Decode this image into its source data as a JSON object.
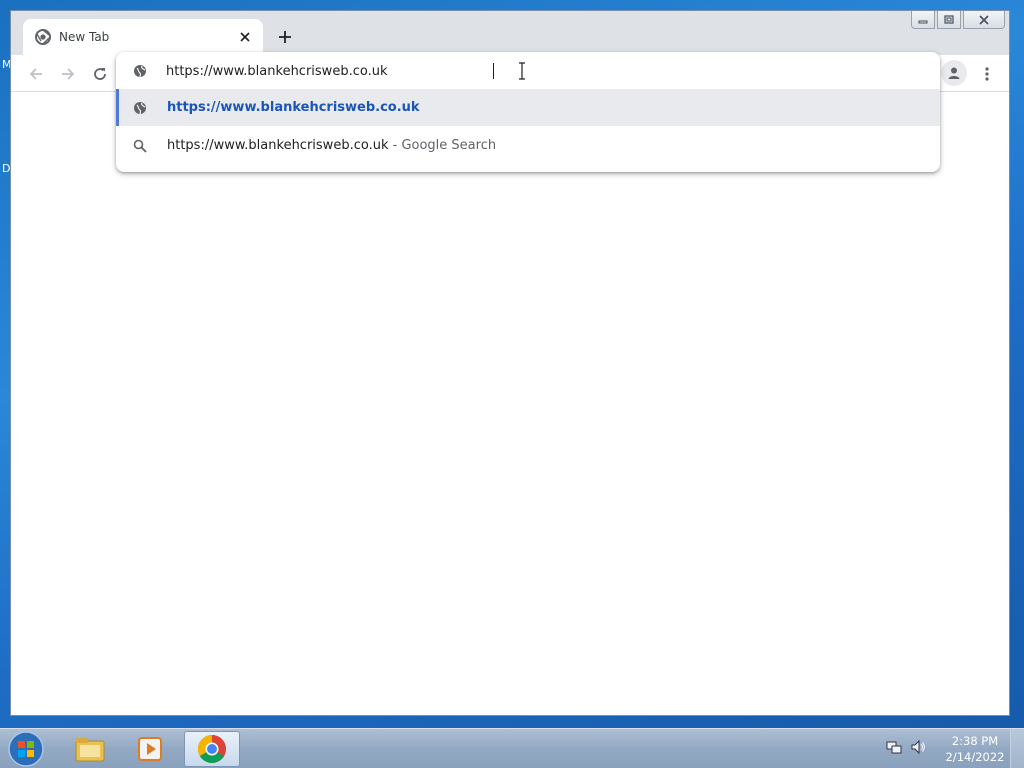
{
  "desktop": {
    "edge_letters": [
      "M",
      "D"
    ]
  },
  "browser": {
    "tab": {
      "title": "New Tab",
      "favicon": "chrome-icon",
      "close_icon": "close-icon"
    },
    "new_tab_icon": "plus-icon",
    "toolbar": {
      "back_icon": "arrow-left-icon",
      "forward_icon": "arrow-right-icon",
      "reload_icon": "reload-icon",
      "profile_icon": "profile-icon",
      "menu_icon": "kebab-menu-icon"
    },
    "omnibox": {
      "value": "https://www.blankehcrisweb.co.uk",
      "suggestions": [
        {
          "text": "https://www.blankehcrisweb.co.uk",
          "icon": "globe-icon",
          "selected": true
        },
        {
          "text": "https://www.blankehcrisweb.co.uk",
          "suffix": "- Google Search",
          "icon": "search-icon",
          "selected": false
        }
      ]
    },
    "colors": {
      "accent": "#4e7bd9",
      "link": "#1a56b8"
    }
  },
  "taskbar": {
    "pinned": [
      "windows-explorer-icon",
      "media-player-icon",
      "chrome-icon"
    ],
    "clock": {
      "time": "2:38 PM",
      "date": "2/14/2022"
    }
  }
}
